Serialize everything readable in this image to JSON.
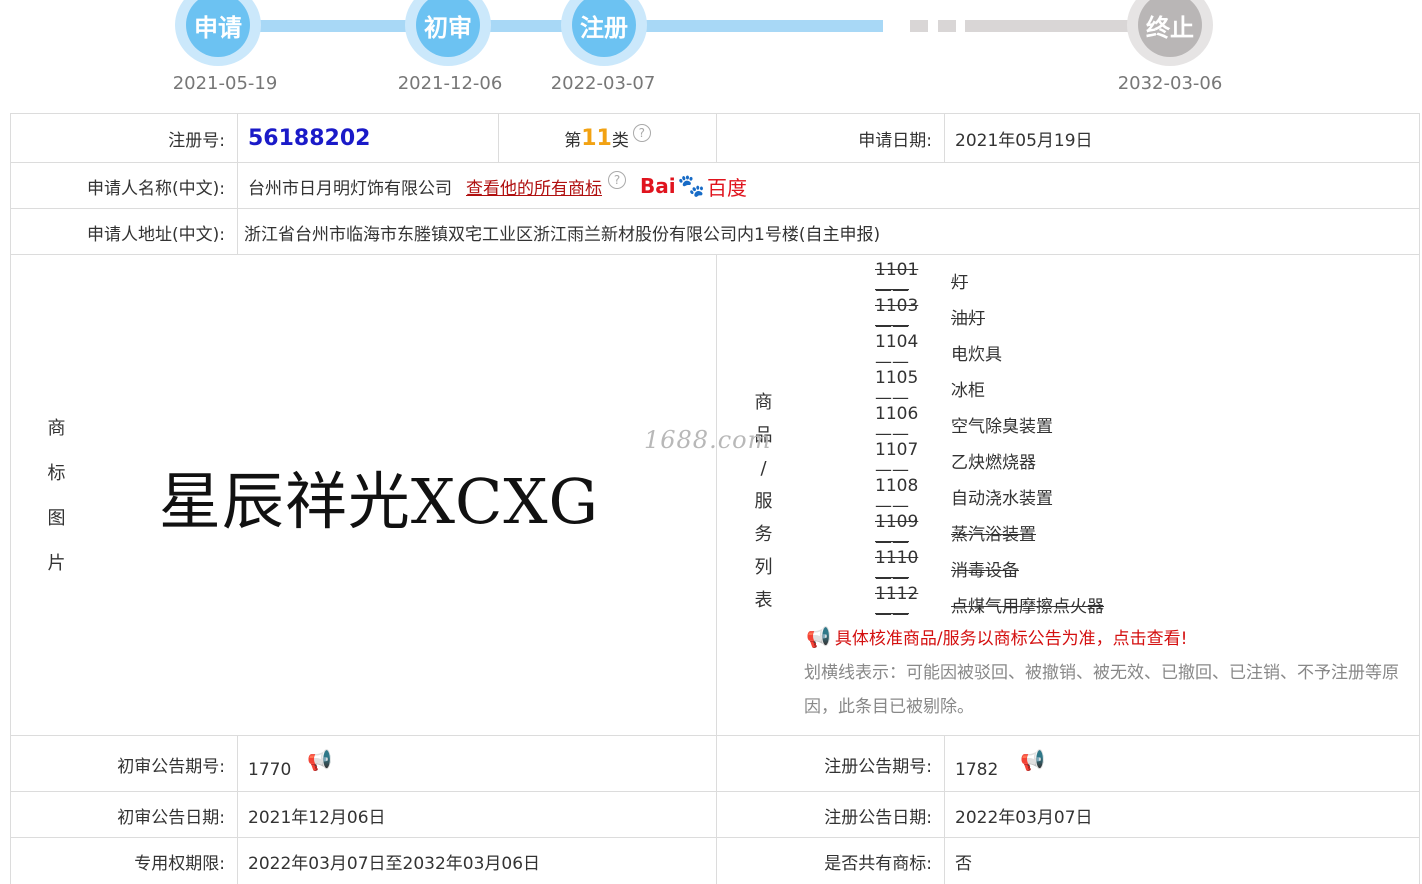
{
  "timeline": {
    "nodes": [
      {
        "label": "申请",
        "date": "2021-05-19"
      },
      {
        "label": "初审",
        "date": "2021-12-06"
      },
      {
        "label": "注册",
        "date": "2022-03-07"
      },
      {
        "label": "终止",
        "date": "2032-03-06"
      }
    ]
  },
  "info": {
    "reg_no_label": "注册号:",
    "reg_no": "56188202",
    "class_prefix": "第",
    "class_num": "11",
    "class_suffix": "类",
    "help_icon": "?",
    "apply_date_label": "申请日期:",
    "apply_date": "2021年05月19日",
    "applicant_label": "申请人名称(中文):",
    "applicant": "台州市日月明灯饰有限公司",
    "all_marks_link": "查看他的所有商标",
    "baidu_bai": "Bai",
    "baidu_du": "百度",
    "address_label": "申请人地址(中文):",
    "address": "浙江省台州市临海市东塍镇双宅工业区浙江雨兰新材股份有限公司内1号楼(自主申报)"
  },
  "trademark": {
    "image_label_chars": [
      "商",
      "标",
      "图",
      "片"
    ],
    "text": "星辰祥光XCXG",
    "goods_label_chars": [
      "商",
      "品",
      "/",
      "服",
      "务",
      "列",
      "表"
    ],
    "watermark": "1688.com"
  },
  "goods": [
    {
      "code": "1101——",
      "name": "灯",
      "struck": true
    },
    {
      "code": "1103——",
      "name": "油灯",
      "struck": true
    },
    {
      "code": "1104——",
      "name": "电炊具",
      "struck": false
    },
    {
      "code": "1105——",
      "name": "冰柜",
      "struck": false
    },
    {
      "code": "1106——",
      "name": "空气除臭装置",
      "struck": false
    },
    {
      "code": "1107——",
      "name": "乙炔燃烧器",
      "struck": false
    },
    {
      "code": "1108——",
      "name": "自动浇水装置",
      "struck": false
    },
    {
      "code": "1109——",
      "name": "蒸汽浴装置",
      "struck": true
    },
    {
      "code": "1110——",
      "name": "消毒设备",
      "struck": true
    },
    {
      "code": "1112——",
      "name": "点煤气用摩擦点火器",
      "struck": true
    }
  ],
  "notice": "具体核准商品/服务以商标公告为准，点击查看!",
  "legend": "划横线表示：可能因被驳回、被撤销、被无效、已撤回、已注销、不予注册等原因，此条目已被剔除。",
  "publication": {
    "prelim_no_label": "初审公告期号:",
    "prelim_no": "1770",
    "reg_pub_no_label": "注册公告期号:",
    "reg_pub_no": "1782",
    "prelim_date_label": "初审公告日期:",
    "prelim_date": "2021年12月06日",
    "reg_pub_date_label": "注册公告日期:",
    "reg_pub_date": "2022年03月07日",
    "term_label": "专用权期限:",
    "term": "2022年03月07日至2032年03月06日",
    "shared_label": "是否共有商标:",
    "shared": "否"
  }
}
